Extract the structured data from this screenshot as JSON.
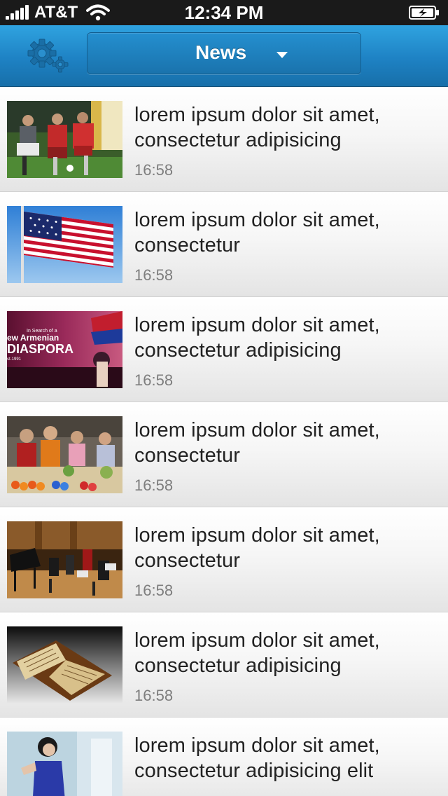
{
  "status_bar": {
    "carrier": "AT&T",
    "time": "12:34 PM"
  },
  "nav": {
    "section_label": "News"
  },
  "news": [
    {
      "title_lines": [
        "lorem ipsum dolor sit amet,",
        "consectetur adipisicing"
      ],
      "time": "16:58",
      "thumb": "football"
    },
    {
      "title_lines": [
        "lorem ipsum dolor sit amet,",
        "consectetur"
      ],
      "time": "16:58",
      "thumb": "flag"
    },
    {
      "title_lines": [
        "lorem ipsum dolor sit amet,",
        "consectetur adipisicing"
      ],
      "time": "16:58",
      "thumb": "diaspora",
      "thumb_text": [
        "In Search of a",
        "ew Armenian",
        "DIASPORA",
        "st-1991"
      ]
    },
    {
      "title_lines": [
        "lorem ipsum dolor sit amet,",
        "consectetur"
      ],
      "time": "16:58",
      "thumb": "children"
    },
    {
      "title_lines": [
        "lorem ipsum dolor sit amet,",
        "consectetur"
      ],
      "time": "16:58",
      "thumb": "orchestra"
    },
    {
      "title_lines": [
        "lorem ipsum dolor sit amet,",
        "consectetur adipisicing"
      ],
      "time": "16:58",
      "thumb": "book"
    },
    {
      "title_lines": [
        "lorem ipsum dolor sit amet,",
        "consectetur adipisicing elit"
      ],
      "time": "",
      "thumb": "woman"
    }
  ]
}
